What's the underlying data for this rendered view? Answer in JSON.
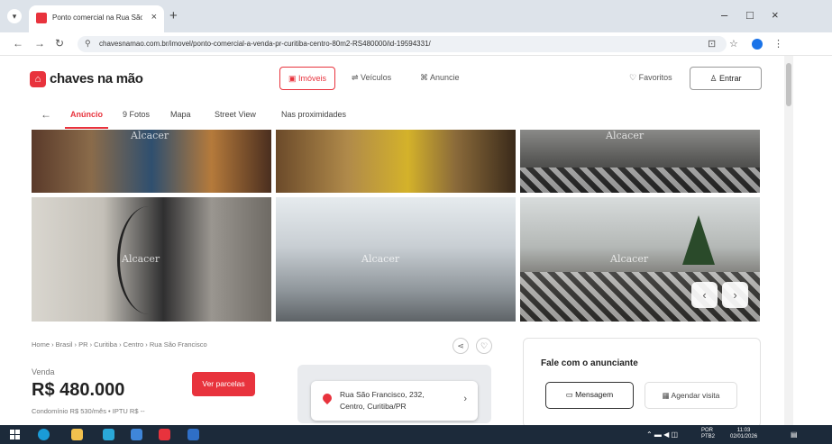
{
  "browser": {
    "tab_title": "Ponto comercial na Rua São Fr",
    "tab_close": "×",
    "new_tab": "+",
    "url": "chavesnamao.com.br/imovel/ponto-comercial-a-venda-pr-curitiba-centro-80m2-RS480000/id-19594331/",
    "window_min": "–",
    "window_max": "□",
    "window_close": "×"
  },
  "site": {
    "logo_text": "chaves na mão",
    "nav_imoveis": "Imóveis",
    "nav_veiculos": "Veículos",
    "nav_anuncie": "Anuncie",
    "favorites": "Favoritos",
    "login": "Entrar"
  },
  "subnav": {
    "items": [
      "Anúncio",
      "9 Fotos",
      "Mapa",
      "Street View",
      "Nas proximidades"
    ]
  },
  "gallery": {
    "watermark": "Alcacer",
    "prev": "‹",
    "next": "›"
  },
  "listing": {
    "breadcrumb": "Home › Brasil › PR › Curitiba › Centro › Rua São Francisco",
    "price_label": "Venda",
    "price": "R$ 480.000",
    "installments_button": "Ver parcelas",
    "fees": "Condomínio R$ 530/mês  •  IPTU R$ --",
    "address_line1": "Rua São Francisco, 232,",
    "address_line2": "Centro, Curitiba/PR"
  },
  "contact": {
    "title": "Fale com o anunciante",
    "message_button": "Mensagem",
    "visit_button": "Agendar visita"
  },
  "taskbar": {
    "lang": "POR",
    "lang2": "PTB2",
    "time": "11:03",
    "date": "02/01/2026"
  },
  "colors": {
    "brand_red": "#e8333d",
    "taskbar": "#1c2a3a"
  }
}
